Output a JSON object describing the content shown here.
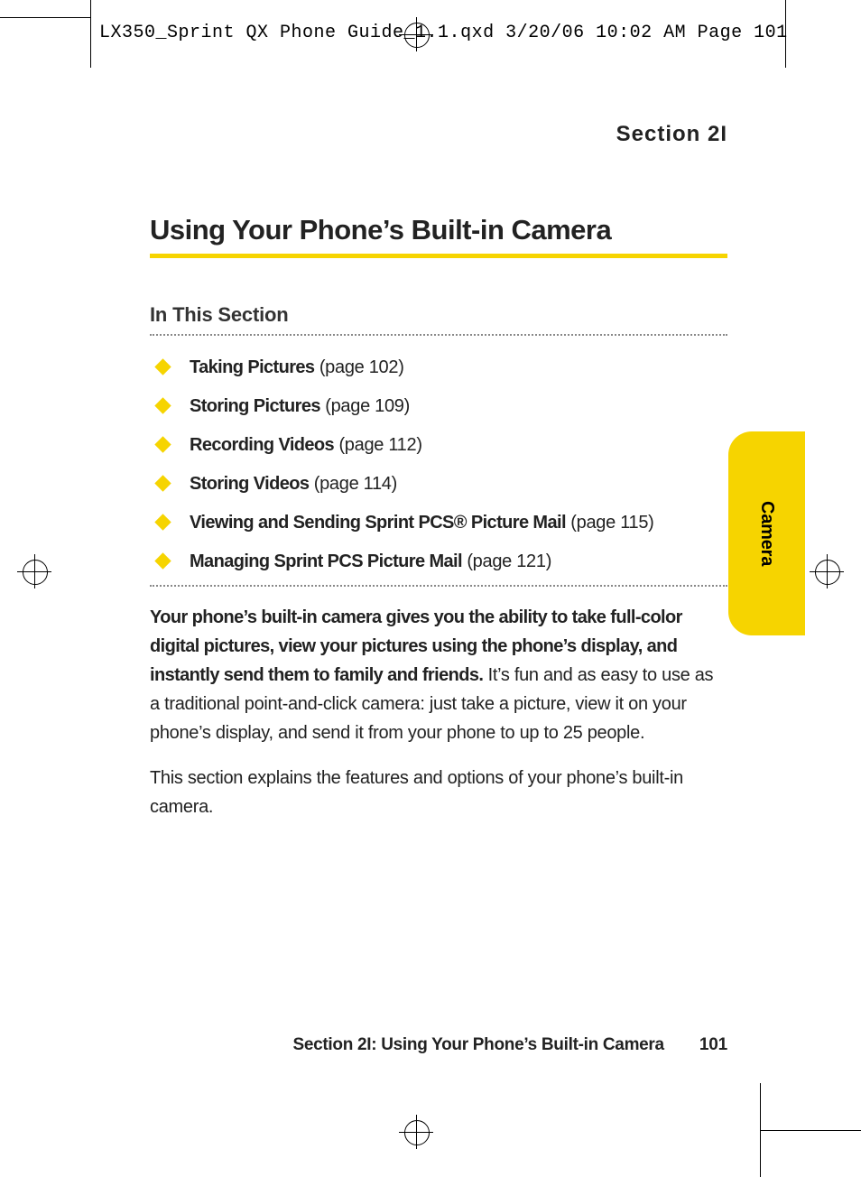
{
  "slug": "LX350_Sprint QX Phone Guide_1.1.qxd  3/20/06  10:02 AM  Page 101",
  "section_label": "Section 2I",
  "title": "Using Your Phone’s Built-in Camera",
  "subhead": "In This Section",
  "toc": [
    {
      "bold": "Taking Pictures",
      "ref": "(page 102)"
    },
    {
      "bold": "Storing Pictures",
      "ref": "(page 109)"
    },
    {
      "bold": "Recording Videos",
      "ref": "(page 112)"
    },
    {
      "bold": "Storing Videos",
      "ref": "(page 114)"
    },
    {
      "bold": "Viewing and Sending Sprint PCS® Picture Mail",
      "ref": "(page 115)"
    },
    {
      "bold": "Managing Sprint PCS Picture Mail",
      "ref": "(page 121)"
    }
  ],
  "para1_bold": "Your phone’s built-in camera gives you the ability to take full-color digital pictures, view your pictures using the phone’s display, and instantly send them to family and friends.",
  "para1_rest": " It’s fun and as easy to use as a traditional point-and-click camera: just take a picture, view it on your phone’s display, and send it from your phone to up to 25 people.",
  "para2": "This section explains the features and options of your phone’s built-in camera.",
  "tab": "Camera",
  "footer_title": "Section 2I: Using Your Phone’s Built-in Camera",
  "footer_page": "101"
}
